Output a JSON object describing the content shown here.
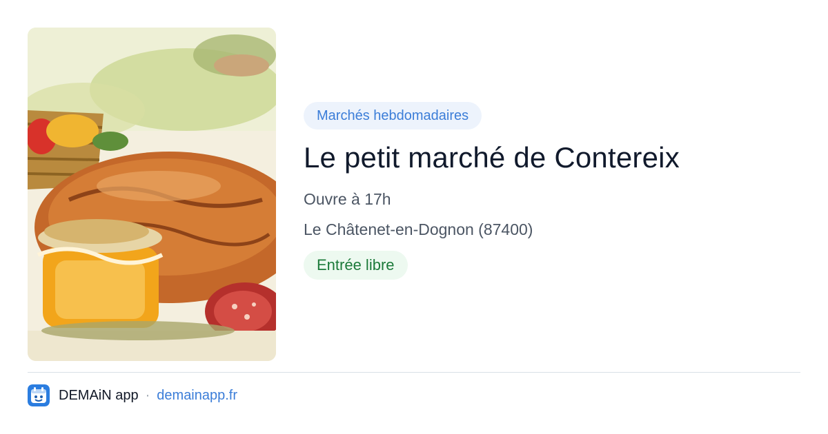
{
  "card": {
    "category": "Marchés hebdomadaires",
    "title": "Le petit marché de Contereix",
    "hours": "Ouvre à 17h",
    "location": "Le Châtenet-en-Dognon (87400)",
    "entry": "Entrée libre"
  },
  "footer": {
    "app_name": "DEMAiN app",
    "separator": "·",
    "link": "demainapp.fr"
  },
  "colors": {
    "category_chip_bg": "#edf3fc",
    "category_chip_text": "#3b7dd8",
    "entry_chip_bg": "#edf9f0",
    "entry_chip_text": "#1c7a3a",
    "link": "#3b7dd8"
  }
}
